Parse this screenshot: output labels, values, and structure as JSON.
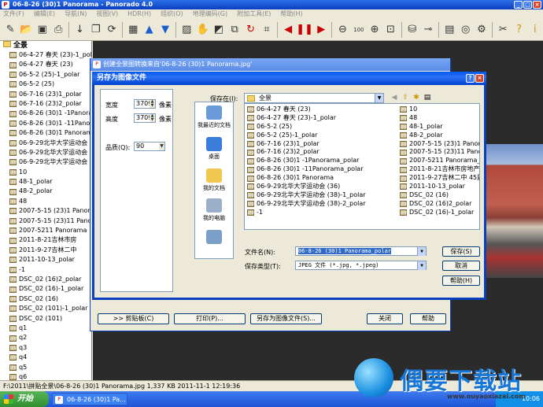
{
  "app": {
    "title": "06-8-26 (30)1 Panorama - Panorado 4.0",
    "menu": [
      "文件(F)",
      "编辑(E)",
      "导航(N)",
      "视图(V)",
      "HDR(H)",
      "组织(O)",
      "地理编码(G)",
      "附加工具(E)",
      "帮助(H)"
    ]
  },
  "tree": {
    "root": "全景",
    "items": [
      "06-4-27 春天 (23)-1_polar",
      "06-4-27 春天 (23)",
      "06-5-2 (25)-1_polar",
      "06-5-2 (25)",
      "06-7-16 (23)1_polar",
      "06-7-16 (23)2_polar",
      "06-8-26 (30)1 -1Panorama",
      "06-8-26 (30)1 -11Panorama",
      "06-8-26 (30)1 Panorama",
      "06-9-29北华大学运动会",
      "06-9-29北华大学运动会",
      "06-9-29北华大学运动会",
      "10",
      "48-1_polar",
      "48-2_polar",
      "48",
      "2007-5-15 (23)1 Panorama",
      "2007-5-15 (23)11 Panorama",
      "2007-5211 Panorama",
      "2011-8-21吉林市房",
      "2011-9-27吉林二中",
      "2011-10-13_polar",
      "-1",
      "DSC_02 (16)2_polar",
      "DSC_02 (16)-1_polar",
      "DSC_02 (16)",
      "DSC_02 (101)-1_polar",
      "DSC_02 (101)",
      "q1",
      "q2",
      "q3",
      "q4",
      "q5",
      "q6"
    ]
  },
  "convert_window": {
    "title": "创建全景图转换来自'06-8-26 (30)1 Panorama.jpg'",
    "buttons": [
      ">> 剪贴板(C)",
      "打印(P)...",
      "另存为图像文件(S)...",
      "关闭",
      "帮助"
    ]
  },
  "save_dialog": {
    "title": "另存为图像文件",
    "width_label": "宽度",
    "width_value": "3709",
    "width_unit": "像素",
    "height_label": "高度",
    "height_value": "3709",
    "height_unit": "像素",
    "quality_label": "品质(Q):",
    "quality_value": "90",
    "lookin_label": "保存在(I):",
    "lookin_value": "全景",
    "places": [
      "我最近的文档",
      "桌面",
      "我的文档",
      "我的电脑",
      ""
    ],
    "files_col1": [
      "06-4-27 春天 (23)",
      "06-4-27 春天 (23)-1_polar",
      "06-5-2 (25)",
      "06-5-2 (25)-1_polar",
      "06-7-16 (23)1_polar",
      "06-7-16 (23)2_polar",
      "06-8-26 (30)1 -1Panorama_polar",
      "06-8-26 (30)1 -11Panorama_polar",
      "06-8-26 (30)1 Panorama",
      "06-9-29北华大学运动会 (36)",
      "06-9-29北华大学运动会 (38)-1_polar",
      "06-9-29北华大学运动会 (38)-2_polar",
      "-1"
    ],
    "files_col2": [
      "10",
      "48",
      "48-1_polar",
      "48-2_polar",
      "2007-5-15 (23)1 Panora",
      "2007-5-15 (23)11 Panora",
      "2007-5211 Panorama_p",
      "2011-8-21吉林市房地产",
      "2011-9-27吉林二中 45届",
      "2011-10-13_polar",
      "DSC_02 (16)",
      "DSC_02 (16)2_polar",
      "DSC_02 (16)-1_polar"
    ],
    "filename_label": "文件名(N):",
    "filename_value": "06-8-26 (30)1 Panorama_polar",
    "filetype_label": "保存类型(T):",
    "filetype_value": "JPEG 文件 (*.jpg, *.jpeg)",
    "save_button": "保存(S)",
    "cancel_button": "取消",
    "help_button": "帮助(H)"
  },
  "status": {
    "text": "F:\\2011\\拼贴全景\\06-8-26 (30)1 Panorama.jpg   1,337 KB   2011-11-1 12:19:36"
  },
  "taskbar": {
    "start": "开始",
    "task": "06-8-26 (30)1 Pa...",
    "clock": "10:06"
  },
  "watermark": {
    "text": "偶要下载站",
    "sub": "www.ouyaoxiazai.com"
  }
}
